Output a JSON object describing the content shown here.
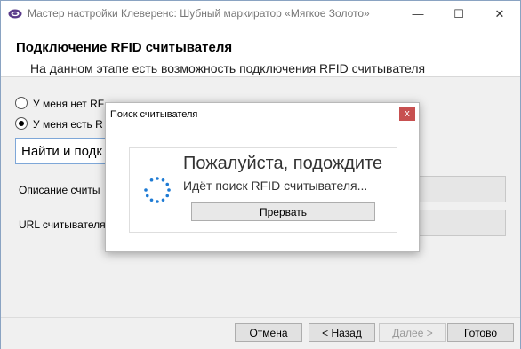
{
  "window": {
    "title": "Мастер настройки Клеверенс: Шубный маркиратор «Мягкое Золото»",
    "minimize_glyph": "—",
    "maximize_glyph": "☐",
    "close_glyph": "✕",
    "app_icon": "app-logo-icon"
  },
  "header": {
    "title": "Подключение RFID считывателя",
    "subtitle": "На данном этапе есть возможность подключения RFID считывателя"
  },
  "options": [
    {
      "label": "У меня нет RFID считывателя",
      "visible_label": "У меня нет RF",
      "checked": false
    },
    {
      "label": "У меня есть R",
      "visible_label": "У меня есть R",
      "checked": true
    }
  ],
  "find_button_label": "Найти и подк",
  "fields": {
    "description_label": "Описание считы",
    "url_label": "URL считывателя"
  },
  "footer": {
    "cancel": "Отмена",
    "back": "< Назад",
    "next": "Далее >",
    "done": "Готово"
  },
  "dialog": {
    "title": "Поиск считывателя",
    "close_glyph": "x",
    "wait_title": "Пожалуйста, подождите",
    "wait_subtitle": "Идёт поиск RFID считывателя...",
    "abort": "Прервать",
    "accent_color": "#1e7bd4"
  }
}
